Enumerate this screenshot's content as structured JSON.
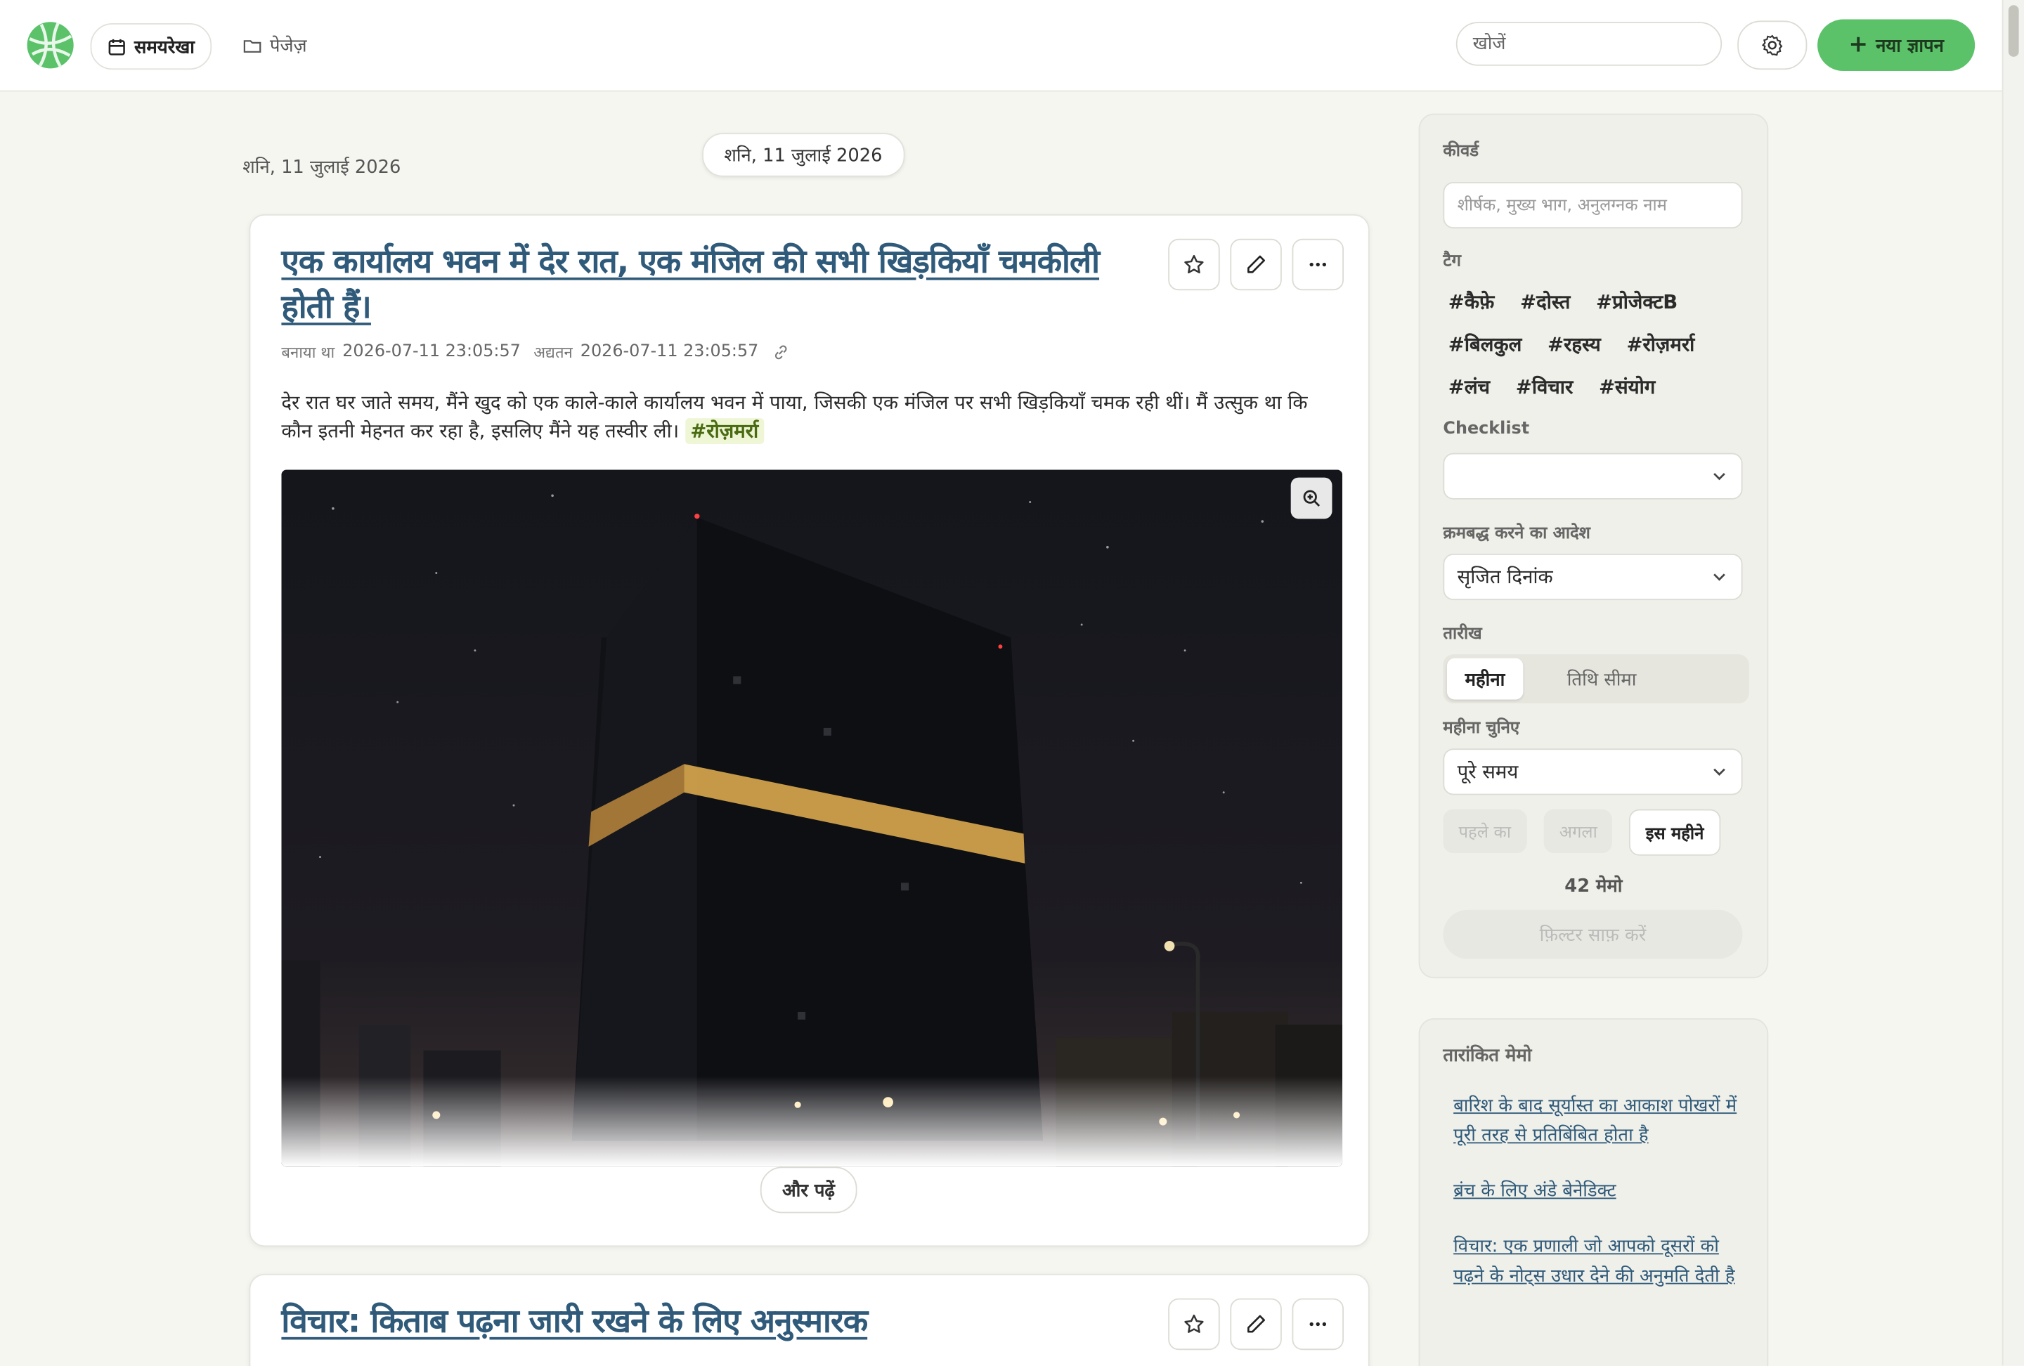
{
  "header": {
    "nav": [
      {
        "label": "समयरेखा"
      },
      {
        "label": "पेजेज़"
      }
    ],
    "search_placeholder": "खोजें",
    "new_button": "नया ज्ञापन"
  },
  "timeline": {
    "date_left": "शनि, 11 जुलाई 2026",
    "date_chip": "शनि, 11 जुलाई 2026"
  },
  "memos": [
    {
      "title": "एक कार्यालय भवन में देर रात, एक मंजिल की सभी खिड़कियाँ चमकीली होती हैं।",
      "created_label": "बनाया था",
      "created": "2026-07-11 23:05:57",
      "updated_label": "अद्यतन",
      "updated": "2026-07-11 23:05:57",
      "body": "देर रात घर जाते समय, मैंने खुद को एक काले-काले कार्यालय भवन में पाया, जिसकी एक मंजिल पर सभी खिड़कियाँ चमक रही थीं। मैं उत्सुक था कि कौन इतनी मेहनत कर रहा है, इसलिए मैंने यह तस्वीर ली।",
      "tag": "#रोज़मर्रा",
      "read_more": "और पढ़ें"
    },
    {
      "title": "विचार: किताब पढ़ना जारी रखने के लिए अनुस्मारक"
    }
  ],
  "sidebar": {
    "keywords_label": "कीवर्ड",
    "keywords_placeholder": "शीर्षक, मुख्य भाग, अनुलग्नक नाम",
    "tags_label": "टैग",
    "tag_rows": [
      [
        "#कैफ़े",
        "#दोस्त",
        "#प्रोजेक्टB"
      ],
      [
        "#बिलकुल",
        "#रहस्य",
        "#रोज़मर्रा"
      ],
      [
        "#लंच",
        "#विचार",
        "#संयोग"
      ]
    ],
    "checklist_label": "Checklist",
    "checklist_value": "",
    "sort_label": "क्रमबद्ध करने का आदेश",
    "sort_value": "सृजित दिनांक",
    "date_label": "तारीख",
    "date_modes": [
      "महीना",
      "तिथि सीमा"
    ],
    "month_label": "महीना चुनिए",
    "month_value": "पूरे समय",
    "prev_button": "पहले का",
    "next_button": "अगला",
    "this_month_button": "इस महीने",
    "memo_count": "42 मेमो",
    "clear_button": "फ़िल्टर साफ़ करें"
  },
  "starred": {
    "title": "तारांकित मेमो",
    "items": [
      "बारिश के बाद सूर्यास्त का आकाश पोखरों में पूरी तरह से प्रतिबिंबित होता है",
      "ब्रंच के लिए अंडे बेनेडिक्ट",
      "विचार: एक प्रणाली जो आपको दूसरों को पढ़ने के नोट्स उधार देने की अनुमति देती है"
    ]
  },
  "colors": {
    "accent_green": "#5bc26a",
    "link_blue": "#2f5a7a",
    "tag_highlight": "#eef6d6"
  },
  "icons": [
    "globe-logo-icon",
    "calendar-icon",
    "folder-icon",
    "gear-icon",
    "plus-icon",
    "star-icon",
    "pencil-icon",
    "more-icon",
    "link-icon",
    "zoom-in-icon",
    "chevron-down-icon"
  ]
}
